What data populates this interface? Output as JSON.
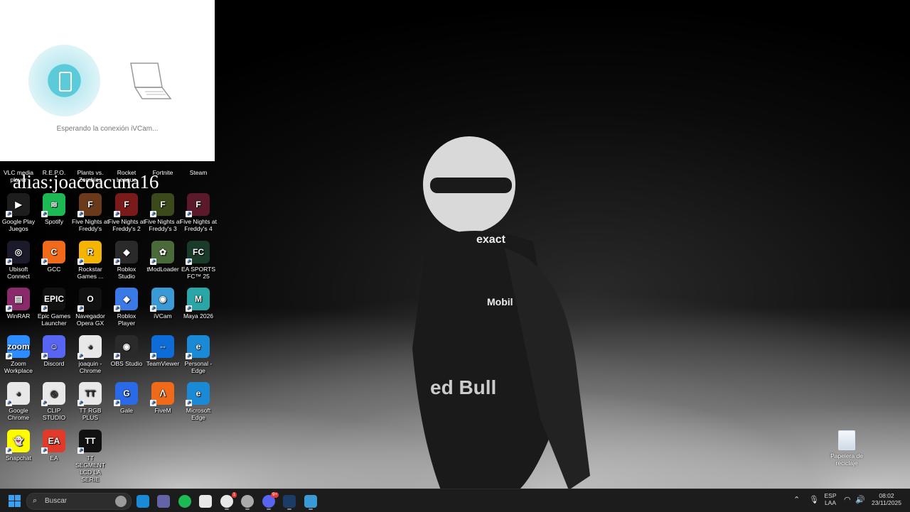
{
  "ivcam": {
    "status": "Esperando la conexión iVCam..."
  },
  "alias": "alias:joacoacuna16",
  "desktop_icons": [
    {
      "label": "VLC media player",
      "color": "#f08a1c",
      "glyph": "▲"
    },
    {
      "label": "R.E.P.O.",
      "color": "#c8341b",
      "glyph": "R"
    },
    {
      "label": "Plants vs. Zombies",
      "color": "#7ab43a",
      "glyph": "P"
    },
    {
      "label": "Rocket League",
      "color": "#1a5fc4",
      "glyph": "R"
    },
    {
      "label": "Fortnite",
      "color": "#3aa9e6",
      "glyph": "F"
    },
    {
      "label": "Steam",
      "color": "#1b3c66",
      "glyph": "S"
    },
    {
      "label": "Google Play Juegos",
      "color": "#1d1d1d",
      "glyph": "▶"
    },
    {
      "label": "Spotify",
      "color": "#1db954",
      "glyph": "≋"
    },
    {
      "label": "Five Nights at Freddy's",
      "color": "#6a3a1a",
      "glyph": "F"
    },
    {
      "label": "Five Nights at Freddy's 2",
      "color": "#7a1a1a",
      "glyph": "F"
    },
    {
      "label": "Five Nights at Freddy's 3",
      "color": "#3a4a1a",
      "glyph": "F"
    },
    {
      "label": "Five Nights at Freddy's 4",
      "color": "#5a1a2a",
      "glyph": "F"
    },
    {
      "label": "Ubisoft Connect",
      "color": "#1a1a2a",
      "glyph": "◎"
    },
    {
      "label": "GCC",
      "color": "#f06a1a",
      "glyph": "C"
    },
    {
      "label": "Rockstar Games ...",
      "color": "#f4b400",
      "glyph": "R"
    },
    {
      "label": "Roblox Studio",
      "color": "#2a2a2a",
      "glyph": "◆"
    },
    {
      "label": "tModLoader",
      "color": "#4a6a3a",
      "glyph": "✿"
    },
    {
      "label": "EA SPORTS FC™ 25",
      "color": "#1a3a2a",
      "glyph": "FC"
    },
    {
      "label": "WinRAR",
      "color": "#8a2a6a",
      "glyph": "▤"
    },
    {
      "label": "Epic Games Launcher",
      "color": "#111111",
      "glyph": "EPIC"
    },
    {
      "label": "Navegador Opera GX",
      "color": "#111111",
      "glyph": "O"
    },
    {
      "label": "Roblox Player",
      "color": "#3a7ae6",
      "glyph": "◆"
    },
    {
      "label": "iVCam",
      "color": "#3a9ad6",
      "glyph": "◉"
    },
    {
      "label": "Maya 2026",
      "color": "#2aa6a6",
      "glyph": "M"
    },
    {
      "label": "Zoom Workplace",
      "color": "#2d8cff",
      "glyph": "zoom"
    },
    {
      "label": "Discord",
      "color": "#5865f2",
      "glyph": "☺"
    },
    {
      "label": "joaquin - Chrome",
      "color": "#e8e8e8",
      "glyph": "◕"
    },
    {
      "label": "OBS Studio",
      "color": "#2a2a2a",
      "glyph": "◉"
    },
    {
      "label": "TeamViewer",
      "color": "#0e6cd8",
      "glyph": "⇔"
    },
    {
      "label": "Personal - Edge",
      "color": "#1a8ad6",
      "glyph": "e"
    },
    {
      "label": "Google Chrome",
      "color": "#e8e8e8",
      "glyph": "◕"
    },
    {
      "label": "CLIP STUDIO",
      "color": "#e8e8e8",
      "glyph": "◎"
    },
    {
      "label": "TT RGB PLUS",
      "color": "#e8e8e8",
      "glyph": "TT"
    },
    {
      "label": "Gale",
      "color": "#2a6ae6",
      "glyph": "G"
    },
    {
      "label": "FiveM",
      "color": "#f06a1a",
      "glyph": "ᐱ"
    },
    {
      "label": "Microsoft Edge",
      "color": "#1a8ad6",
      "glyph": "e"
    },
    {
      "label": "Snapchat",
      "color": "#fffc00",
      "glyph": "👻"
    },
    {
      "label": "EA",
      "color": "#e23a2a",
      "glyph": "EA"
    },
    {
      "label": "TT SEGMENT LCD LA SERIE",
      "color": "#111111",
      "glyph": "TT"
    }
  ],
  "recycle_bin": {
    "label": "Papelera de reciclaje"
  },
  "taskbar": {
    "search_label": "Buscar",
    "apps": [
      {
        "name": "edge-app",
        "color": "#1a8ad6"
      },
      {
        "name": "teams-app",
        "color": "#6264a7"
      },
      {
        "name": "spotify-app",
        "color": "#1db954"
      },
      {
        "name": "store-app",
        "color": "#e8e8e8"
      },
      {
        "name": "chrome-app",
        "color": "#e8e8e8",
        "badge": "1"
      },
      {
        "name": "github-app",
        "color": "#aaaaaa"
      },
      {
        "name": "discord-app",
        "color": "#5865f2",
        "badge": "9+"
      },
      {
        "name": "steam-app",
        "color": "#1b3c66"
      },
      {
        "name": "ivcam-app",
        "color": "#3a9ad6"
      }
    ],
    "lang_top": "ESP",
    "lang_bottom": "LAA",
    "time": "08:02",
    "date": "23/11/2025"
  }
}
